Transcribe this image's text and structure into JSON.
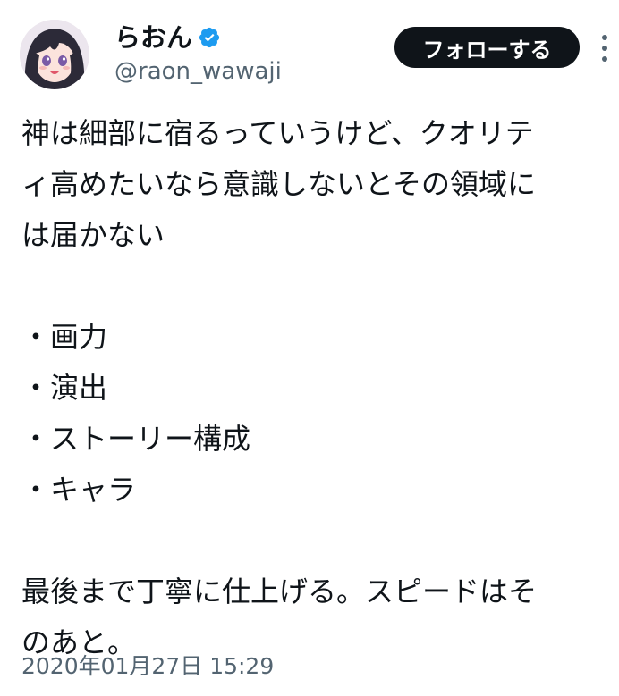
{
  "author": {
    "display_name": "らおん",
    "handle": "@raon_wawaji",
    "verified": true
  },
  "actions": {
    "follow_label": "フォローする"
  },
  "tweet": {
    "lines": [
      "神は細部に宿るっていうけど、クオリテ",
      "ィ高めたいなら意識しないとその領域に",
      "は届かない",
      "",
      "・画力",
      "・演出",
      "・ストーリー構成",
      "・キャラ",
      "",
      "最後まで丁寧に仕上げる。スピードはそ",
      "のあと。"
    ],
    "timestamp": "2020年01月27日 15:29"
  },
  "colors": {
    "text_primary": "#0f1419",
    "text_secondary": "#536471",
    "verified_blue": "#1d9bf0",
    "button_bg": "#0f1419",
    "button_text": "#ffffff"
  },
  "icons": {
    "verified": "verified-badge-icon",
    "more": "more-vertical-icon",
    "avatar": "avatar"
  }
}
